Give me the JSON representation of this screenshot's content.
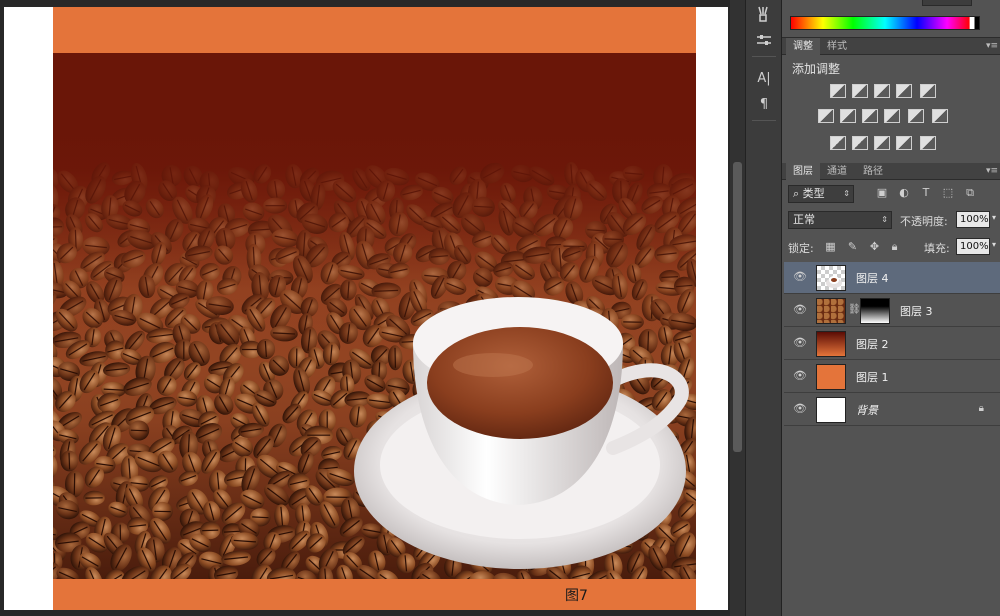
{
  "caption": "图7",
  "adjust_panel": {
    "tabs": [
      "调整",
      "样式"
    ],
    "title": "添加调整"
  },
  "layers_panel": {
    "tabs": [
      "图层",
      "通道",
      "路径"
    ],
    "filter_label": "类型",
    "blend_mode": "正常",
    "opacity_label": "不透明度:",
    "opacity_value": "100%",
    "lock_label": "锁定:",
    "fill_label": "填充:",
    "fill_value": "100%",
    "layers": [
      {
        "name": "图层 4",
        "selected": true,
        "visible": true
      },
      {
        "name": "图层 3",
        "selected": false,
        "visible": true,
        "has_mask": true
      },
      {
        "name": "图层 2",
        "selected": false,
        "visible": true
      },
      {
        "name": "图层 1",
        "selected": false,
        "visible": true
      },
      {
        "name": "背景",
        "selected": false,
        "visible": true,
        "locked": true
      }
    ]
  },
  "colors": {
    "orange_band": "#e4743a",
    "selected_layer": "#5e6a7c",
    "panel_bg": "#535353"
  }
}
